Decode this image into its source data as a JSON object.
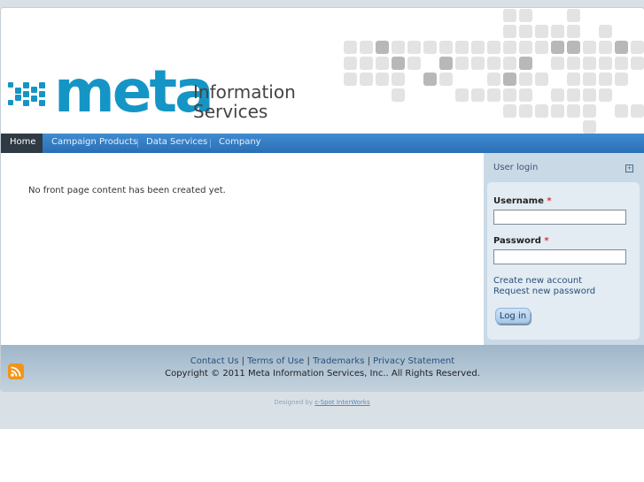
{
  "header": {
    "logo_word": "meta",
    "logo_tagline_line1": "Information",
    "logo_tagline_line2": "Services",
    "brand_color": "#1595c5"
  },
  "nav": {
    "items": [
      {
        "label": "Home",
        "active": true
      },
      {
        "label": "Campaign Products",
        "active": false
      },
      {
        "label": "Data Services",
        "active": false
      },
      {
        "label": "Company",
        "active": false
      }
    ]
  },
  "main": {
    "message": "No front page content has been created yet."
  },
  "sidebar": {
    "block_title": "User login",
    "toggle_icon": "collapse-icon",
    "username_label": "Username",
    "password_label": "Password",
    "required_marker": "*",
    "username_value": "",
    "password_value": "",
    "create_account": "Create new account",
    "request_password": "Request new password",
    "login_button": "Log in"
  },
  "footer": {
    "rss_icon": "rss-icon",
    "links": [
      "Contact Us",
      "Terms of Use",
      "Trademarks",
      "Privacy Statement"
    ],
    "link_separator": "|",
    "copyright": "Copyright © 2011 Meta Information Services, Inc.. All Rights Reserved."
  },
  "credit": {
    "prefix": "Designed by",
    "link": "c-Spot InterWorks"
  }
}
